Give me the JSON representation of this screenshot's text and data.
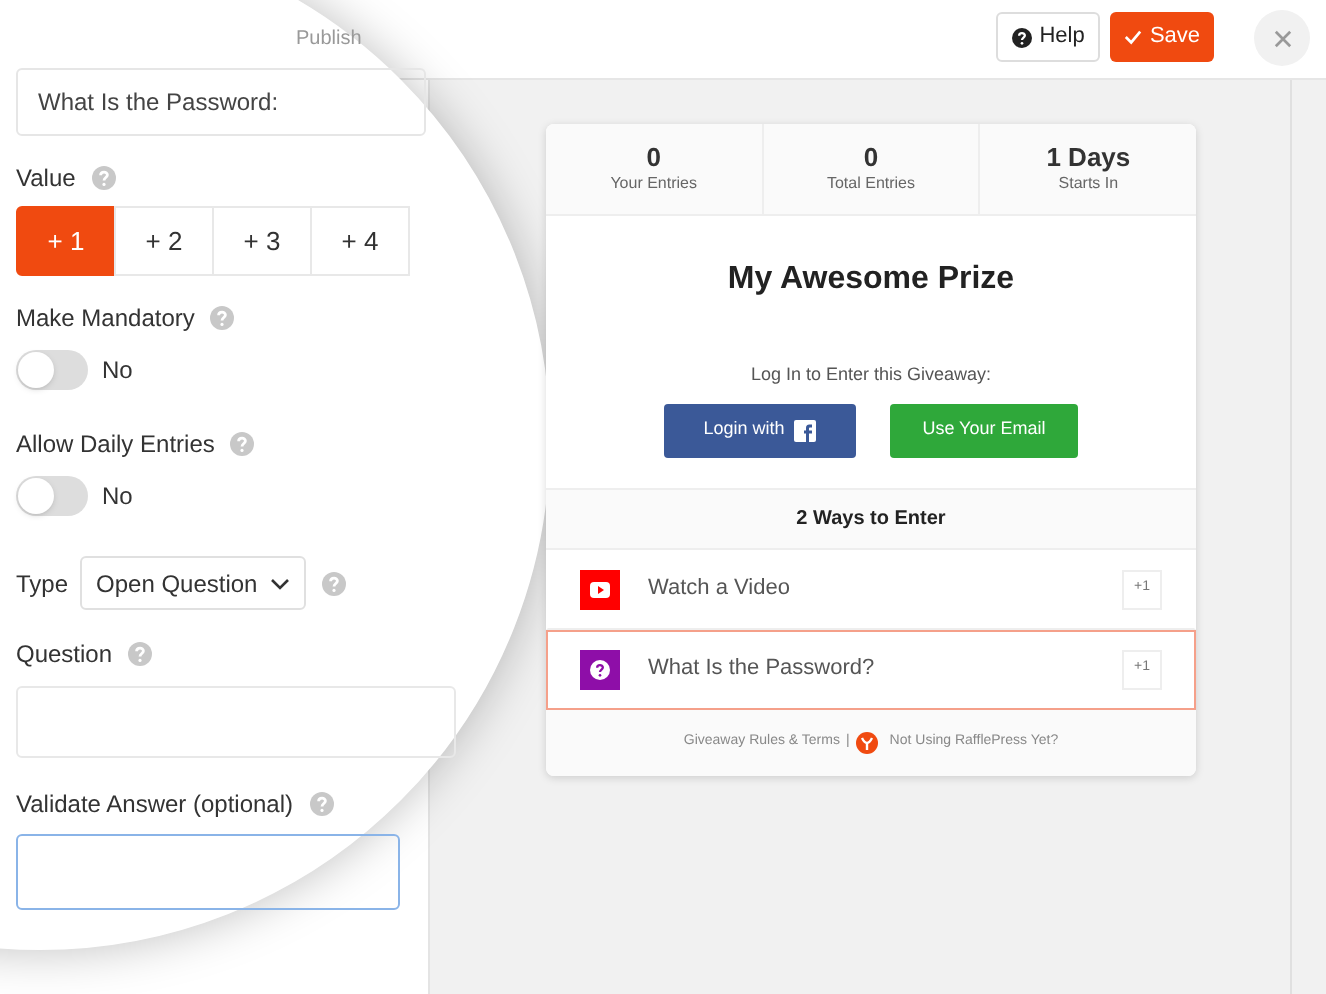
{
  "top_bar": {
    "tabs": [
      {
        "label": "Publish",
        "selected": false
      }
    ],
    "help_button": "Help",
    "save_button": "Save"
  },
  "editor": {
    "title_field": {
      "value": "What Is the Password:"
    },
    "value": {
      "label": "Value",
      "options": [
        {
          "label": "+ 1",
          "selected": true
        },
        {
          "label": "+ 2",
          "selected": false
        },
        {
          "label": "+ 3",
          "selected": false
        },
        {
          "label": "+ 4",
          "selected": false
        }
      ]
    },
    "toggles": [
      {
        "label": "Make Mandatory",
        "on": false,
        "state_text": "No"
      },
      {
        "label": "Allow Daily Entries",
        "on": false,
        "state_text": "No"
      }
    ],
    "type": {
      "label": "Type",
      "value": "Open Question"
    },
    "question": {
      "label": "Question"
    },
    "validate_answer": {
      "label": "Validate Answer (optional)"
    }
  },
  "preview": {
    "stats": [
      {
        "value": "0",
        "label": "Your Entries"
      },
      {
        "value": "0",
        "label": "Total Entries"
      },
      {
        "value": "1 Days",
        "label": "Starts In"
      }
    ],
    "prize_title": "My Awesome Prize",
    "login_prompt": "Log In to Enter this Giveaway:",
    "login_buttons": [
      {
        "kind": "facebook",
        "label": "Login with"
      },
      {
        "kind": "email",
        "label": "Use Your Email"
      }
    ],
    "ways_heading": "2 Ways to Enter",
    "entries": [
      {
        "kind": "video",
        "label": "Watch a Video",
        "points": "+1",
        "selected": false,
        "color": "#ff0000"
      },
      {
        "kind": "question",
        "label": "What Is the Password?",
        "points": "+1",
        "selected": true,
        "color": "#8e0ea8"
      }
    ],
    "footer": {
      "rules_link": "Giveaway Rules & Terms",
      "separator": "|",
      "promo_link": "Not Using RafflePress Yet?"
    }
  }
}
